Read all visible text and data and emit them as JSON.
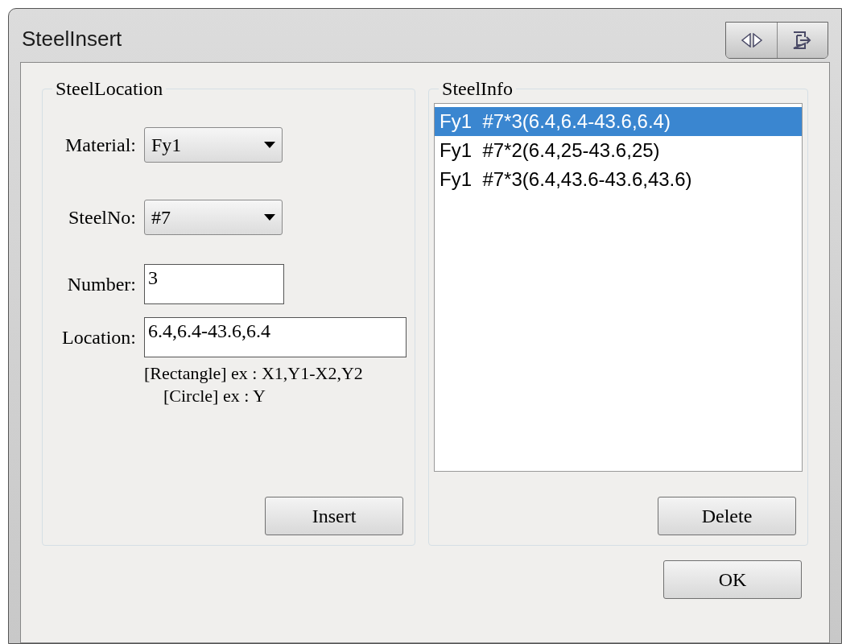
{
  "window": {
    "title": "SteelInsert"
  },
  "steel_location": {
    "title": "SteelLocation",
    "fields": [
      {
        "label": "Material:",
        "kind": "dropdown",
        "value": "Fy1"
      },
      {
        "label": "SteelNo:",
        "kind": "dropdown",
        "value": "#7"
      },
      {
        "label": "Number:",
        "kind": "text",
        "value": "3"
      },
      {
        "label": "Location:",
        "kind": "text",
        "value": "6.4,6.4-43.6,6.4"
      }
    ],
    "hints": [
      "[Rectangle] ex : X1,Y1-X2,Y2",
      "[Circle] ex : Y"
    ],
    "button": "Insert"
  },
  "steel_info": {
    "title": "SteelInfo",
    "items": [
      {
        "text": "Fy1  #7*3(6.4,6.4-43.6,6.4)",
        "selected": true
      },
      {
        "text": "Fy1  #7*2(6.4,25-43.6,25)",
        "selected": false
      },
      {
        "text": "Fy1  #7*3(6.4,43.6-43.6,43.6)",
        "selected": false
      }
    ],
    "button": "Delete"
  },
  "ok_button": "OK"
}
